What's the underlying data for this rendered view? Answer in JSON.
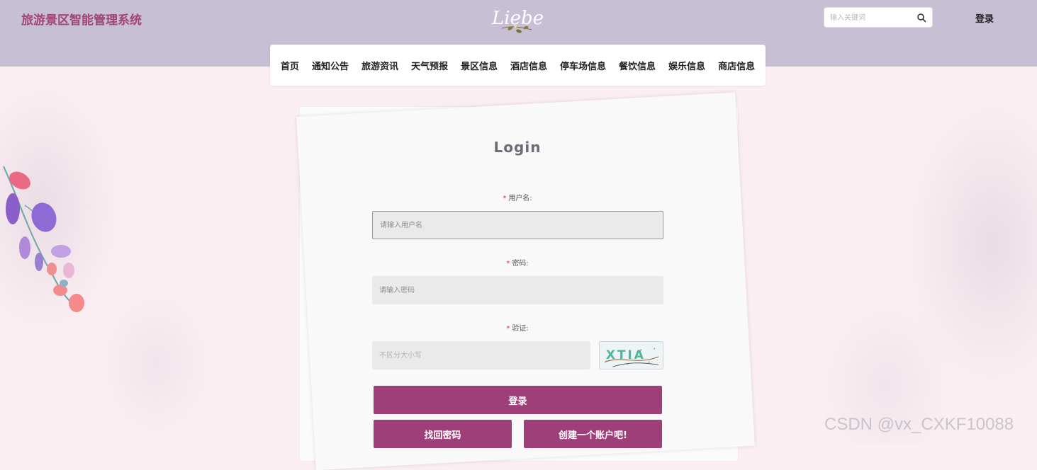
{
  "header": {
    "site_title": "旅游景区智能管理系统",
    "logo_text": "Liebe",
    "search_placeholder": "输入关键词",
    "login_label": "登录"
  },
  "nav": {
    "items": [
      "首页",
      "通知公告",
      "旅游资讯",
      "天气预报",
      "景区信息",
      "酒店信息",
      "停车场信息",
      "餐饮信息",
      "娱乐信息",
      "商店信息"
    ]
  },
  "login_form": {
    "title": "Login",
    "required_mark": "*",
    "username_label": "用户名:",
    "username_placeholder": "请输入用户名",
    "password_label": "密码:",
    "password_placeholder": "请输入密码",
    "captcha_label": "验证:",
    "captcha_placeholder": "不区分大小写",
    "captcha_text": "XTIA",
    "submit_label": "登录",
    "forgot_label": "找回密码",
    "register_label": "创建一个账户吧!"
  },
  "colors": {
    "header_bg": "#c7bfd4",
    "brand": "#a0457a",
    "button": "#9e3f79",
    "page_bg": "#fbeef3"
  },
  "watermark": "CSDN @vx_CXKF10088"
}
